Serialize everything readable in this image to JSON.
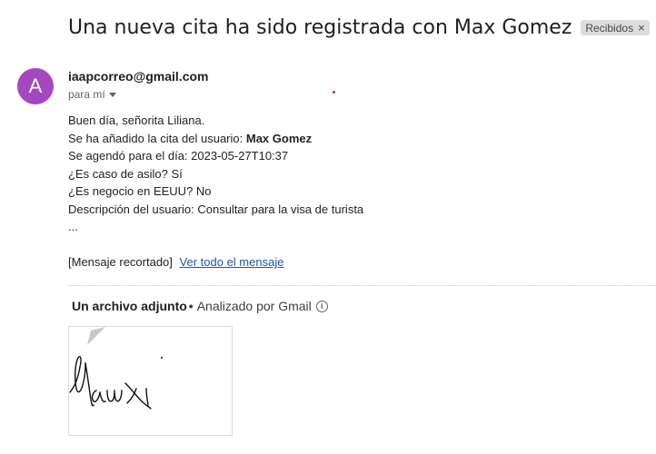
{
  "email": {
    "subject": "Una nueva cita ha sido registrada con Max Gomez",
    "label": "Recibidos",
    "label_remove": "×",
    "avatar_letter": "A",
    "avatar_color": "#a447c0",
    "sender": "iaapcorreo@gmail.com",
    "recipient": "para mí",
    "body": {
      "greeting": "Buen día, señorita Liliana.",
      "line2_prefix": "Se ha añadido la cita del usuario: ",
      "user_name": "Max Gomez",
      "line3": "Se agendó para el día: 2023-05-27T10:37",
      "line4": "¿Es caso de asilo? Sí",
      "line5": "¿Es negocio en EEUU? No",
      "line6": "Descripción del usuario: Consultar para la visa de turista",
      "ellipsis": "..."
    },
    "clipped_note": "[Mensaje recortado]",
    "view_full_link": "Ver todo el mensaje",
    "link_color": "#1a57b3"
  },
  "attachments": {
    "count_label": "Un archivo adjunto",
    "separator": "•",
    "scanned_label": "Analizado por Gmail",
    "info_icon": "i"
  }
}
